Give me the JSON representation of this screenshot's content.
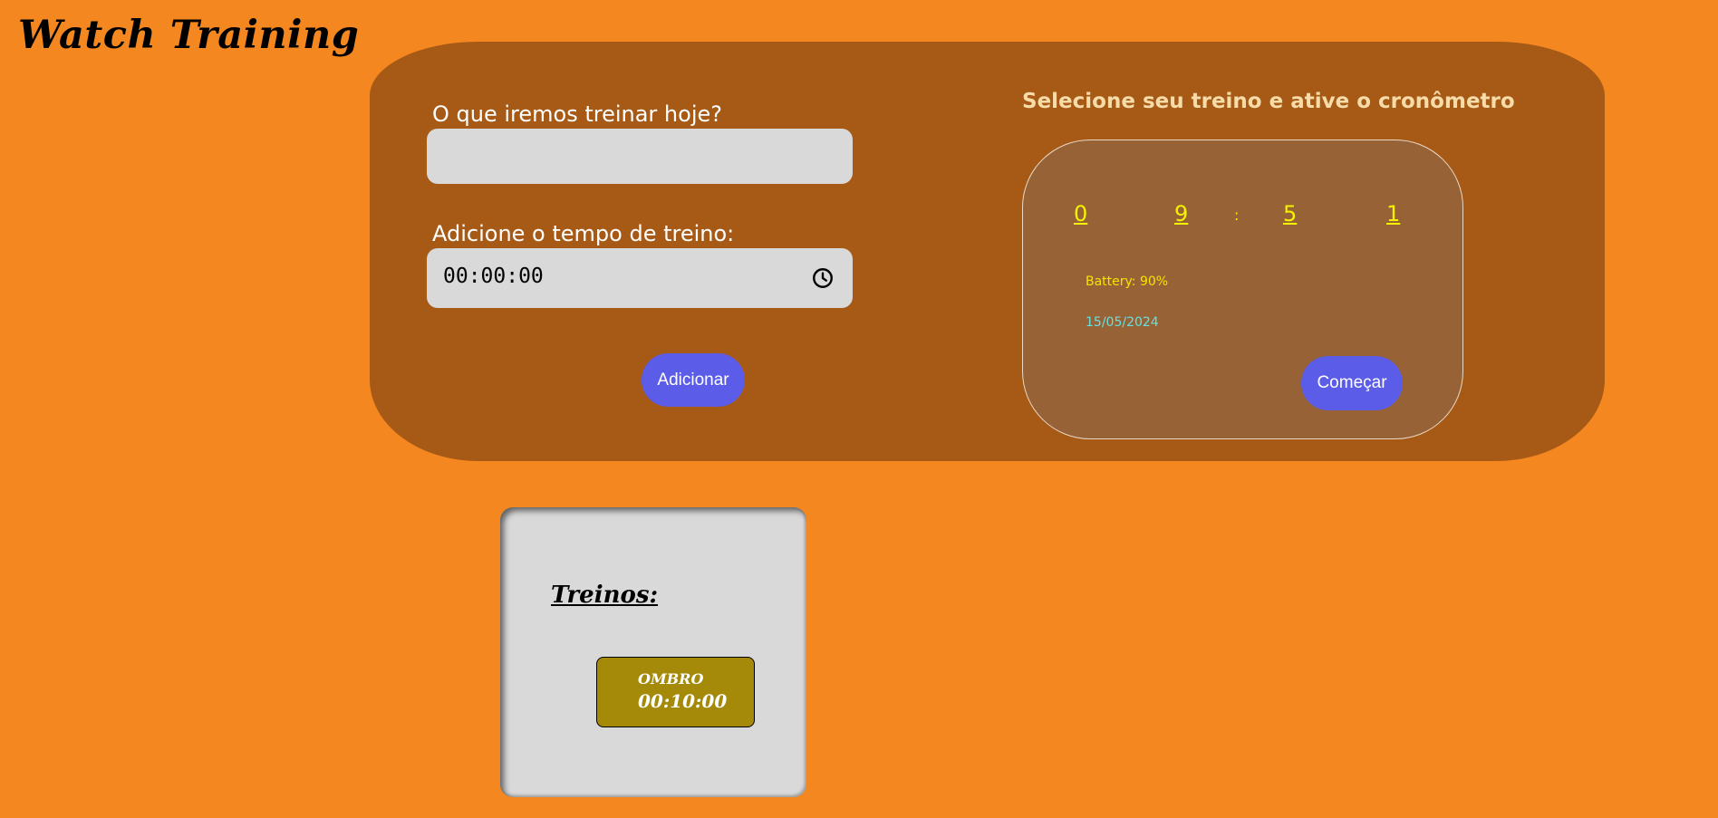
{
  "app": {
    "title": "Watch Training"
  },
  "form": {
    "workout_label": "O que iremos treinar hoje?",
    "workout_value": "",
    "time_label": "Adicione o tempo de treino:",
    "time_value": "00:00:00",
    "add_button": "Adicionar"
  },
  "watch": {
    "heading": "Selecione seu treino e ative o cronômetro",
    "digits": [
      "0",
      "9",
      ":",
      "5",
      "1"
    ],
    "battery": "Battery: 90%",
    "date": "15/05/2024",
    "start_button": "Começar"
  },
  "workouts": {
    "heading": "Treinos:",
    "items": [
      {
        "name": "OMBRO",
        "time": "00:10:00"
      }
    ]
  },
  "colors": {
    "background": "#f58720",
    "panel": "#a65a16",
    "accent_button": "#5b5ce8",
    "digit_color": "#f5f200",
    "date_color": "#66e0e0",
    "workout_item": "#a48a08"
  },
  "icons": {
    "time_picker": "clock-icon"
  }
}
